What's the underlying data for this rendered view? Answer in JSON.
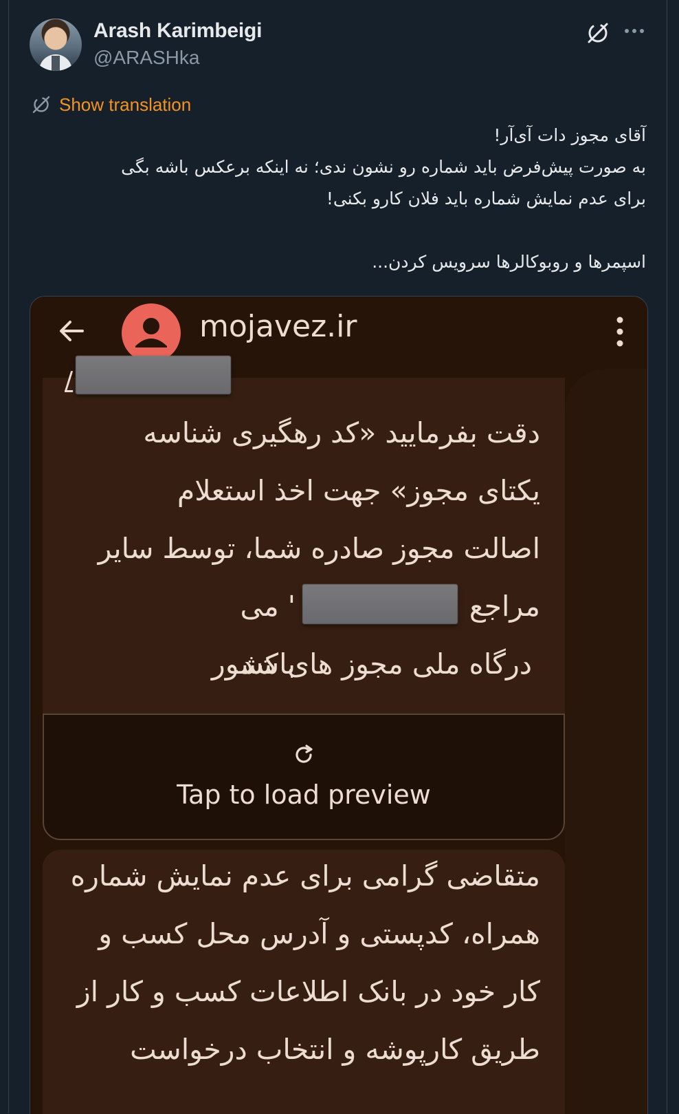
{
  "author": {
    "name": "Arash Karimbeigi",
    "handle": "@ARASHka"
  },
  "translate": {
    "label": "Show translation"
  },
  "tweet": {
    "lines": [
      "آقای مجوز دات آی‌آر!",
      "به صورت پیش‌فرض باید شماره رو نشون ندی؛ نه اینکه برعکس باشه بگی",
      "برای عدم نمایش شماره باید فلان کارو بکنی!",
      "اسپمرها و روبوکالرها سرویس کردن..."
    ]
  },
  "media": {
    "title": "mojavez.ir",
    "slash": "/",
    "message1_lines": [
      "دقت بفرمایید «کد رهگیری شناسه",
      "یکتای مجوز» جهت اخذ استعلام",
      "اصالت مجوز صادره شما، توسط سایر",
      "مراجع",
      "' می باشد.",
      "درگاه ملی مجوز های کشور"
    ],
    "preview_label": "Tap to load preview",
    "message2_lines": [
      "متقاضی گرامی برای عدم نمایش شماره",
      "همراه، کدپستی و آدرس محل کسب و",
      "کار خود در بانک اطلاعات کسب و کار از",
      "طریق کارپوشه و انتخاب درخواست"
    ]
  },
  "colors": {
    "background": "#15202b",
    "accent_translate": "#f4931f",
    "media_bg": "#261409",
    "bubble_bg": "#361f12",
    "contact_avatar": "#ea6459"
  },
  "icons": [
    "grok-icon",
    "more-icon",
    "translate-icon",
    "back-arrow-icon",
    "person-icon",
    "kebab-icon",
    "refresh-icon"
  ]
}
